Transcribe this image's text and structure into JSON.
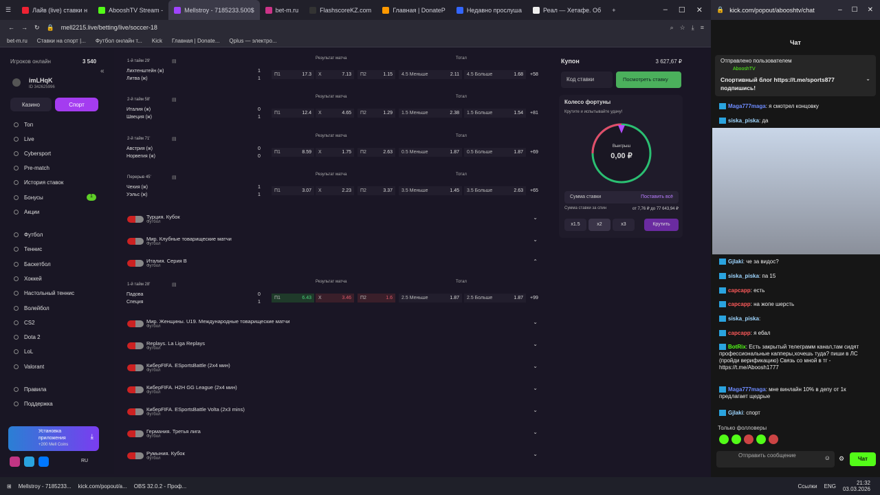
{
  "tabs": [
    "Лайв (live) ставки н",
    "AbooshTV Stream -",
    "Mellstroy - 7185233.500$",
    "bet-m.ru",
    "FlashscoreKZ.com",
    "Главная | DonateP",
    "Недавно прослуша",
    "Реал — Хетафе. Об"
  ],
  "url": "mell2215.live/betting/live/soccer-18",
  "bookmarks": [
    "bet-m.ru",
    "Ставки на спорт |...",
    "Футбол онлайн т...",
    "Kick",
    "Главная | Donate...",
    "Qplus — электро..."
  ],
  "sidebar": {
    "players_label": "Игроков онлайн",
    "players_count": "3 540",
    "username": "imLHqK",
    "user_id": "ID 342625996",
    "casino": "Казино",
    "sport": "Спорт",
    "nav": [
      "Топ",
      "Live",
      "Cybersport",
      "Pre-match",
      "История ставок",
      "Бонусы",
      "Акции"
    ],
    "bonus_badge": "1",
    "sports": [
      "Футбол",
      "Теннис",
      "Баскетбол",
      "Хоккей",
      "Настольный теннис",
      "Волейбол",
      "CS2",
      "Dota 2",
      "LoL",
      "Valorant"
    ],
    "rules": "Правила",
    "support": "Поддержка",
    "install_title": "Установка",
    "install_sub1": "приложения",
    "install_sub2": "+200 Mell Coins",
    "lang": "RU"
  },
  "matches": [
    {
      "period": "1-й тайм 29'",
      "home": "Лихтенштейн (ж)",
      "away": "Литва (ж)",
      "s1": "1",
      "s2": "1",
      "p1": "17.3",
      "x": "7.13",
      "p2": "1.15",
      "tu": "4.5 Меньше",
      "tuv": "2.11",
      "to": "4.5 Больше",
      "tov": "1.68",
      "more": "+58"
    },
    {
      "period": "2-й тайм 58'",
      "home": "Италия (ж)",
      "away": "Швеция (ж)",
      "s1": "0",
      "s2": "1",
      "p1": "12.4",
      "x": "4.65",
      "p2": "1.29",
      "tu": "1.5 Меньше",
      "tuv": "2.38",
      "to": "1.5 Больше",
      "tov": "1.54",
      "more": "+81"
    },
    {
      "period": "2-й тайм 71'",
      "home": "Австрия (ж)",
      "away": "Норвегия (ж)",
      "s1": "0",
      "s2": "0",
      "p1": "8.59",
      "x": "1.75",
      "p2": "2.63",
      "tu": "0.5 Меньше",
      "tuv": "1.87",
      "to": "0.5 Больше",
      "tov": "1.87",
      "more": "+69"
    },
    {
      "period": "Перерыв 45'",
      "home": "Чехия (ж)",
      "away": "Уэльс (ж)",
      "s1": "1",
      "s2": "1",
      "p1": "3.07",
      "x": "2.23",
      "p2": "3.37",
      "tu": "3.5 Меньше",
      "tuv": "1.45",
      "to": "3.5 Больше",
      "tov": "2.63",
      "more": "+65"
    }
  ],
  "col_result": "Результат матча",
  "col_total": "Тотал",
  "lbl_p1": "П1",
  "lbl_x": "X",
  "lbl_p2": "П2",
  "leagues": [
    {
      "name": "Турция. Кубок",
      "sport": "Футбол"
    },
    {
      "name": "Мир. Клубные товарищеские матчи",
      "sport": "Футбол"
    },
    {
      "name": "Италия. Серия B",
      "sport": "Футбол"
    },
    {
      "name": "Мир. Женщины. U19. Международные товарищеские матчи",
      "sport": "Футбол"
    },
    {
      "name": "Replays. La Liga Replays",
      "sport": "Футбол"
    },
    {
      "name": "КиберFIFA. ESportsBattle (2x4 мин)",
      "sport": "Футбол"
    },
    {
      "name": "КиберFIFA. H2H GG League (2x4 мин)",
      "sport": "Футбол"
    },
    {
      "name": "КиберFIFA. ESportsBattle Volta (2x3 mins)",
      "sport": "Футбол"
    },
    {
      "name": "Германия. Третья лига",
      "sport": "Футбол"
    },
    {
      "name": "Румыния. Кубок",
      "sport": "Футбол"
    }
  ],
  "italy_match": {
    "period": "1-й тайм 28'",
    "home": "Падова",
    "away": "Специя",
    "s1": "0",
    "s2": "1",
    "p1": "6.43",
    "x": "3.46",
    "p2": "1.6",
    "tu": "2.5 Меньше",
    "tuv": "1.87",
    "to": "2.5 Больше",
    "tov": "1.87",
    "more": "+99"
  },
  "coupon": {
    "title": "Купон",
    "balance": "3 627,67 ₽",
    "code": "Код ставки",
    "view": "Посмотреть ставку",
    "wheel_title": "Колесо фортуны",
    "wheel_sub": "Крутите и испытывайте удачу!",
    "win_label": "Выигрыш",
    "win_value": "0,00 ₽",
    "stake": "Сумма ставки",
    "all": "Поставить всё",
    "stake_note": "Сумма ставки за спин",
    "stake_range": "от 7,76 ₽ до 77 643,94 ₽",
    "m1": "x1.5",
    "m2": "x2",
    "m3": "x3",
    "spin": "Крутить"
  },
  "chat": {
    "url": "kick.com/popout/abooshtv/chat",
    "title": "Чат",
    "pinned_by": "Отправлено пользователем",
    "pinned_user": "AbooshTV",
    "pinned_text": "Спортивный блог https://t.me/sports877 подпишись!",
    "messages": [
      {
        "nick": "Maga777maga",
        "color": "#6e8cff",
        "text": ": я смотрел концовку"
      },
      {
        "nick": "siska_piska",
        "color": "#9fd6ff",
        "text": ": да"
      }
    ],
    "messages2": [
      {
        "nick": "Gjlaki",
        "color": "#9fd6ff",
        "text": ": че за видос?"
      },
      {
        "nick": "siska_piska",
        "color": "#9fd6ff",
        "text": ": па 15"
      },
      {
        "nick": "сарсарр",
        "color": "#ff5a5a",
        "text": ": есть"
      },
      {
        "nick": "сарсарр",
        "color": "#ff5a5a",
        "text": ": на жопе шерсть"
      },
      {
        "nick": "siska_piska",
        "color": "#9fd6ff",
        "text": ":"
      },
      {
        "nick": "сарсарр",
        "color": "#ff5a5a",
        "text": ": я ебал"
      },
      {
        "nick": "BotRix",
        "color": "#53fc18",
        "text": ": Есть закрытый телеграмм канал,там сидят профессиональные капперы,хочешь туда? пиши в ЛС (пройди верификацию) Связь со мной в тг - https://t.me/Aboosh1777"
      },
      {
        "nick": "Maga777maga",
        "color": "#6e8cff",
        "text": ": мне винлайн 10% в депу от 1к предлагает щедрые"
      },
      {
        "nick": "Gjlaki",
        "color": "#9fd6ff",
        "text": ": спорт"
      }
    ],
    "followers": "Только фолловеры",
    "send_placeholder": "Отправить сообщение",
    "chat_btn": "Чат"
  },
  "taskbar": {
    "app1": "Mellstroy - 7185233...",
    "app2": "kick.com/popout/a...",
    "app3": "OBS 32.0.2 - Проф...",
    "links": "Ссылки",
    "lang": "ENG",
    "time": "21:32",
    "date": "03.03.2026"
  }
}
